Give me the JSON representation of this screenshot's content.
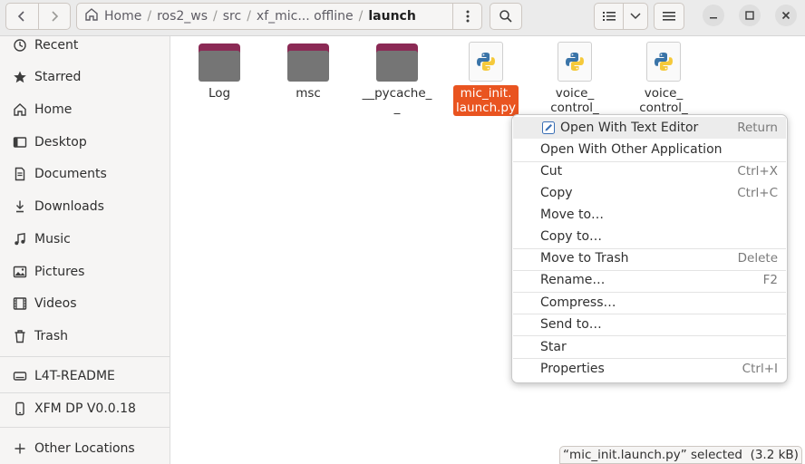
{
  "pathbar": {
    "crumbs": [
      "Home",
      "ros2_ws",
      "src",
      "xf_mic... offline",
      "launch"
    ],
    "separator": "/"
  },
  "sidebar": {
    "items": [
      {
        "label": "Recent",
        "icon": "clock-icon"
      },
      {
        "label": "Starred",
        "icon": "star-icon"
      },
      {
        "label": "Home",
        "icon": "home-icon"
      },
      {
        "label": "Desktop",
        "icon": "desktop-icon"
      },
      {
        "label": "Documents",
        "icon": "document-icon"
      },
      {
        "label": "Downloads",
        "icon": "download-icon"
      },
      {
        "label": "Music",
        "icon": "music-icon"
      },
      {
        "label": "Pictures",
        "icon": "picture-icon"
      },
      {
        "label": "Videos",
        "icon": "video-icon"
      },
      {
        "label": "Trash",
        "icon": "trash-icon"
      }
    ],
    "devices": [
      {
        "label": "L4T-README",
        "icon": "drive-icon"
      },
      {
        "label": "XFM DP V0.0.18",
        "icon": "phone-icon"
      }
    ],
    "other_locations": {
      "label": "Other Locations",
      "icon": "plus-icon"
    }
  },
  "files": [
    {
      "name": "Log",
      "type": "folder"
    },
    {
      "name": "msc",
      "type": "folder"
    },
    {
      "name": "__pycache_\n_",
      "type": "folder"
    },
    {
      "name": "mic_init.\nlaunch.py",
      "type": "python",
      "selected": true
    },
    {
      "name": "voice_\ncontrol_",
      "type": "python"
    },
    {
      "name": "voice_\ncontrol_",
      "type": "python"
    }
  ],
  "context_menu": {
    "items": [
      {
        "label": "Open With Text Editor",
        "accel": "Return",
        "hover": true,
        "icon": "text-editor-icon"
      },
      {
        "label": "Open With Other Application",
        "accel": ""
      },
      {
        "label": "Cut",
        "accel": "Ctrl+X"
      },
      {
        "label": "Copy",
        "accel": "Ctrl+C"
      },
      {
        "label": "Move to…",
        "accel": ""
      },
      {
        "label": "Copy to…",
        "accel": ""
      },
      {
        "label": "Move to Trash",
        "accel": "Delete"
      },
      {
        "label": "Rename…",
        "accel": "F2"
      },
      {
        "label": "Compress…",
        "accel": ""
      },
      {
        "label": "Send to…",
        "accel": ""
      },
      {
        "label": "Star",
        "accel": ""
      },
      {
        "label": "Properties",
        "accel": "Ctrl+I"
      }
    ]
  },
  "status": {
    "text": "“mic_init.launch.py” selected  (3.2 kB)"
  },
  "colors": {
    "accent": "#e95420",
    "folder_tab": "#8b2a55",
    "folder_body": "#757575"
  }
}
